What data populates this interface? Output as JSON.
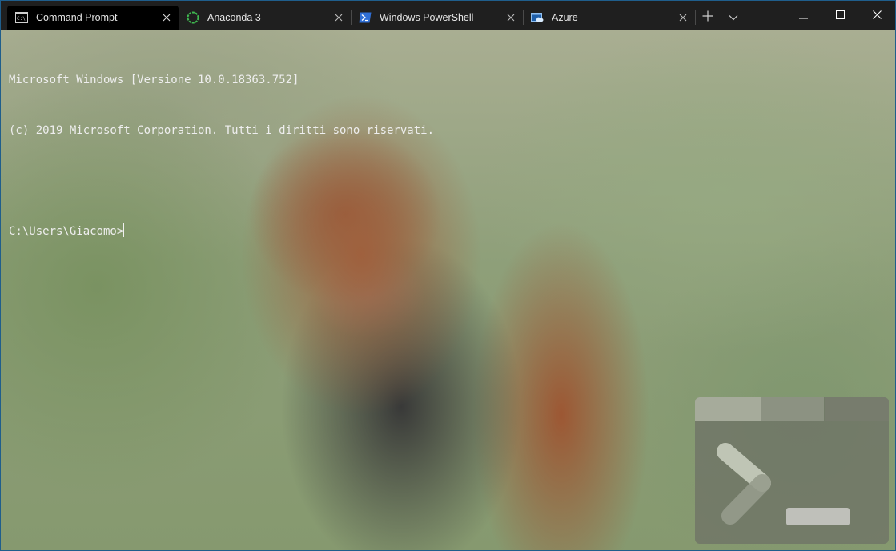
{
  "tabs": [
    {
      "label": "Command Prompt",
      "icon": "command-prompt-icon",
      "active": true
    },
    {
      "label": "Anaconda 3",
      "icon": "anaconda-icon",
      "active": false
    },
    {
      "label": "Windows PowerShell",
      "icon": "powershell-icon",
      "active": false
    },
    {
      "label": "Azure",
      "icon": "azure-cloud-shell-icon",
      "active": false
    }
  ],
  "tab_actions": {
    "new_tab_icon": "plus-icon",
    "dropdown_icon": "chevron-down-icon"
  },
  "window_controls": {
    "minimize_icon": "minimize-icon",
    "maximize_icon": "maximize-icon",
    "close_icon": "close-icon"
  },
  "terminal": {
    "lines": [
      "Microsoft Windows [Versione 10.0.18363.752]",
      "(c) 2019 Microsoft Corporation. Tutti i diritti sono riservati.",
      "",
      "C:\\Users\\Giacomo>"
    ]
  },
  "colors": {
    "tab_bar": "#1f1f1f",
    "active_tab": "#000000",
    "text": "#eeeeee",
    "window_border": "#1f5e8c",
    "anaconda_green": "#3fb950",
    "powershell_blue": "#2f6fd6"
  }
}
